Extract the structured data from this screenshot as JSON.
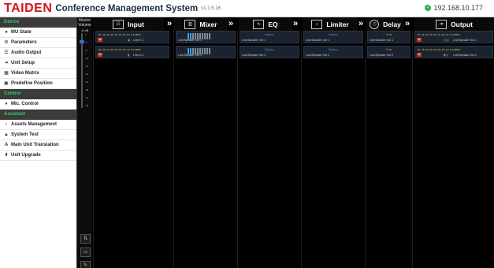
{
  "header": {
    "logo": "TAIDEN",
    "title": "Conference Management System",
    "version": "v1.1.5.16",
    "ip": "192.168.10.177"
  },
  "sidebar": {
    "sections": [
      {
        "title": "Device",
        "items": [
          "MU State",
          "Parameters",
          "Audio Output",
          "Unit Setup",
          "Video Matrix",
          "Predefine Position"
        ]
      },
      {
        "title": "Control",
        "items": [
          "Mic. Control"
        ]
      },
      {
        "title": "Assistant",
        "items": [
          "Assets Management",
          "System Test",
          "Main Unit Translation",
          "Unit Upgrade"
        ]
      }
    ]
  },
  "master": {
    "label": "Master Volume",
    "db": "-8 dB",
    "ticks": [
      "0",
      "-4",
      "-8",
      "-12",
      "-16",
      "-20",
      "-24",
      "-28",
      "-32",
      "-36"
    ],
    "level": 0.1
  },
  "columns": {
    "input": "Input",
    "mixer": "Mixer",
    "eq": "EQ",
    "limiter": "Limiter",
    "delay": "Delay",
    "output": "Output"
  },
  "rows": [
    {
      "input_label": "Line In 1",
      "meter_text": "-54 -48 -42 -36 -30 -24 -18 -12 -6  0 dBFS",
      "mute": "M",
      "mixer_label": "Line/Speaker Out 1",
      "eq_label": "Line/Speaker Out 1",
      "eq_state": "Bypass",
      "limiter_label": "Line/Speaker Out 1",
      "limiter_state": "Bypass",
      "delay_label": "Line/Speaker Out 1",
      "delay_value": "0 ms",
      "output_label": "Line/Speaker Out 1"
    },
    {
      "input_label": "Line In 2",
      "meter_text": "-54 -48 -42 -36 -30 -24 -18 -12 -6  0 dBFS",
      "mute": "M",
      "mixer_label": "Line/Speaker Out 2",
      "eq_label": "Line/Speaker Out 2",
      "eq_state": "Bypass",
      "limiter_label": "Line/Speaker Out 2",
      "limiter_state": "Bypass",
      "delay_label": "Line/Speaker Out 2",
      "delay_value": "0 ms",
      "output_label": "Line/Speaker Out 2"
    }
  ],
  "colors": {
    "brand_red": "#d6101a",
    "section_green": "#3fc36a",
    "mute_red": "#d42a2a",
    "meter_blue": "#3b9ae0",
    "delay_orange": "#e2a230"
  }
}
